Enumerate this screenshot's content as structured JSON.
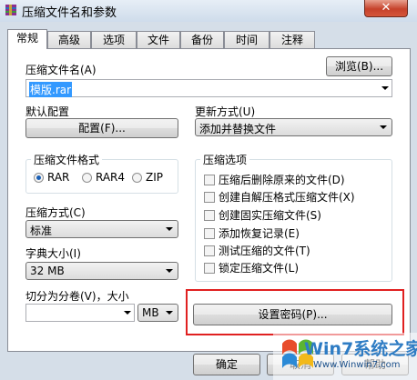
{
  "window": {
    "title": "压缩文件名和参数",
    "close_label": "✕"
  },
  "tabs": [
    {
      "label": "常规",
      "active": true
    },
    {
      "label": "高级"
    },
    {
      "label": "选项"
    },
    {
      "label": "文件"
    },
    {
      "label": "备份"
    },
    {
      "label": "时间"
    },
    {
      "label": "注释"
    }
  ],
  "general": {
    "archive_name_label": "压缩文件名(A)",
    "browse_button": "浏览(B)...",
    "archive_name_value": "模版.rar",
    "default_profile_label": "默认配置",
    "profiles_button": "配置(F)...",
    "update_mode_label": "更新方式(U)",
    "update_mode_value": "添加并替换文件",
    "archive_format": {
      "title": "压缩文件格式",
      "options": [
        "RAR",
        "RAR4",
        "ZIP"
      ],
      "selected": "RAR"
    },
    "compression_method_label": "压缩方式(C)",
    "compression_method_value": "标准",
    "dictionary_size_label": "字典大小(I)",
    "dictionary_size_value": "32 MB",
    "split_label": "切分为分卷(V)，大小",
    "split_value": "",
    "split_unit": "MB",
    "archive_options": {
      "title": "压缩选项",
      "items": [
        {
          "label": "压缩后删除原来的文件(D)",
          "checked": false
        },
        {
          "label": "创建自解压格式压缩文件(X)",
          "checked": false
        },
        {
          "label": "创建固实压缩文件(S)",
          "checked": false
        },
        {
          "label": "添加恢复记录(E)",
          "checked": false
        },
        {
          "label": "测试压缩的文件(T)",
          "checked": false
        },
        {
          "label": "锁定压缩文件(L)",
          "checked": false
        }
      ]
    },
    "set_password_button": "设置密码(P)..."
  },
  "footer": {
    "ok_button": "确定",
    "cancel_button": "取消",
    "help_button": "帮助"
  },
  "watermark": {
    "brand": "Win7系统之家",
    "url": "Www.Winwin7.com"
  }
}
